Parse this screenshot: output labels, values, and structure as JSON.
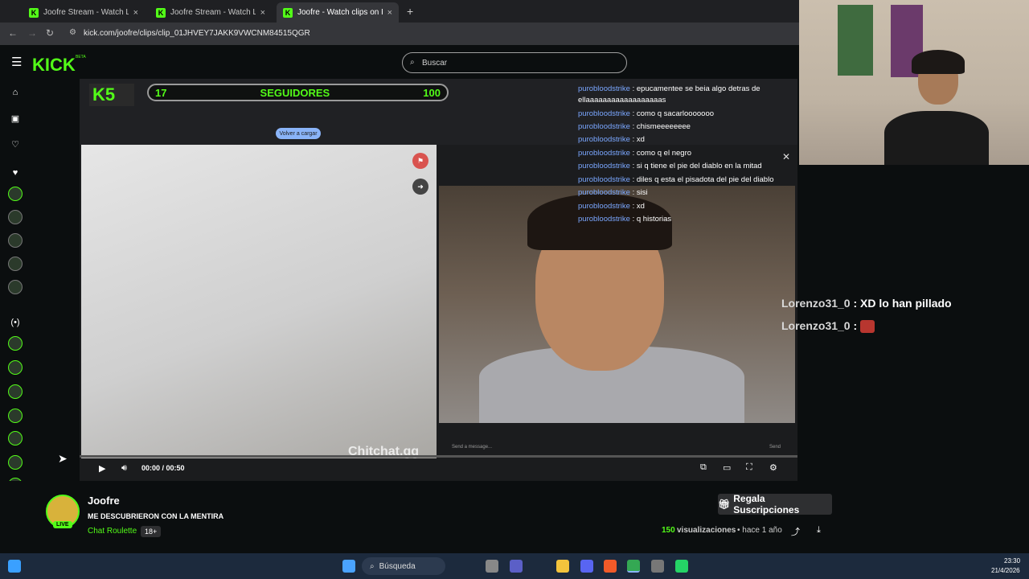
{
  "browser": {
    "tabs": [
      {
        "label": "Joofre Stream - Watch Live on Kick",
        "close": "×"
      },
      {
        "label": "Joofre Stream - Watch Live on Kick",
        "close": "×"
      },
      {
        "label": "Joofre - Watch clips on Kick",
        "close": "×"
      }
    ],
    "new_tab": "+",
    "url": "kick.com/joofre/clips/clip_01JHVEY7JAKK9VWCNM84515QGR"
  },
  "header": {
    "logo": "KICK",
    "logo_badge": "BETA",
    "search_placeholder": "Buscar"
  },
  "video": {
    "follower_goal": {
      "current": "17",
      "label": "SEGUIDORES",
      "target": "100"
    },
    "chat": [
      {
        "user": "purobloodstrike",
        "msg": ": epucamentee se beia algo detras de"
      },
      {
        "user": "",
        "msg": "ellaaaaaaaaaaaaaaaaaas"
      },
      {
        "user": "purobloodstrike",
        "msg": ": como q sacarlooooooo"
      },
      {
        "user": "purobloodstrike",
        "msg": ": chismeeeeeeee"
      },
      {
        "user": "purobloodstrike",
        "msg": ": xd"
      },
      {
        "user": "purobloodstrike",
        "msg": ": como q el negro"
      },
      {
        "user": "purobloodstrike",
        "msg": ": si q tiene el pie del diablo en la mitad"
      },
      {
        "user": "purobloodstrike",
        "msg": ": diles q esta el pisadota del pie del diablo"
      },
      {
        "user": "purobloodstrike",
        "msg": ": sisi"
      },
      {
        "user": "purobloodstrike",
        "msg": ": xd"
      },
      {
        "user": "purobloodstrike",
        "msg": ": q historias"
      }
    ],
    "send_placeholder": "Send a message...",
    "send_label": "Send",
    "watermark": "Chitchat.gg",
    "time": "00:00 / 00:50",
    "reload_button": "Volver a cargar"
  },
  "overlay_chat": [
    {
      "user": "Lorenzo31_0",
      "msg": ": XD lo han pillado"
    },
    {
      "user": "Lorenzo31_0",
      "msg": ":"
    }
  ],
  "clip": {
    "streamer": "Joofre",
    "live_badge": "LIVE",
    "title": "ME DESCUBRIERON CON LA MENTIRA",
    "category": "Chat Roulette",
    "rating": "18+",
    "views_count": "150",
    "views_label": "visualizaciones",
    "age": "• hace 1 año",
    "gift_button": "Regala Suscripciones"
  },
  "taskbar": {
    "search_label": "Búsqueda",
    "time": "23:30",
    "date": "21/4/2026"
  }
}
